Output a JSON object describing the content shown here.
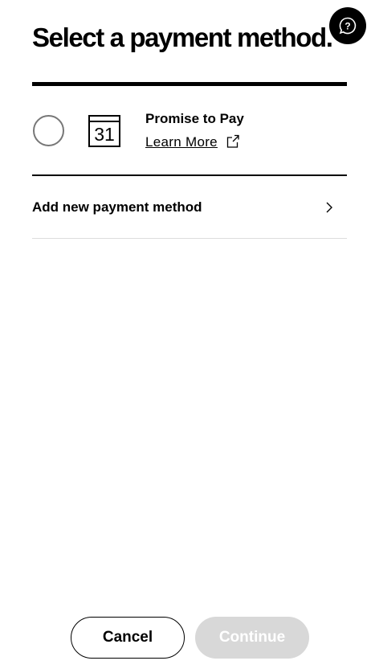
{
  "header": {
    "title": "Select a payment method."
  },
  "help": {
    "icon": "help-chat-icon"
  },
  "payment_options": [
    {
      "label": "Promise to Pay",
      "calendar_day": "31",
      "link": "Learn More",
      "selected": false
    }
  ],
  "add_method": {
    "label": "Add new payment method"
  },
  "footer": {
    "cancel": "Cancel",
    "continue": "Continue",
    "continue_disabled": true
  },
  "colors": {
    "disabled_button": "#d8d8d8"
  }
}
